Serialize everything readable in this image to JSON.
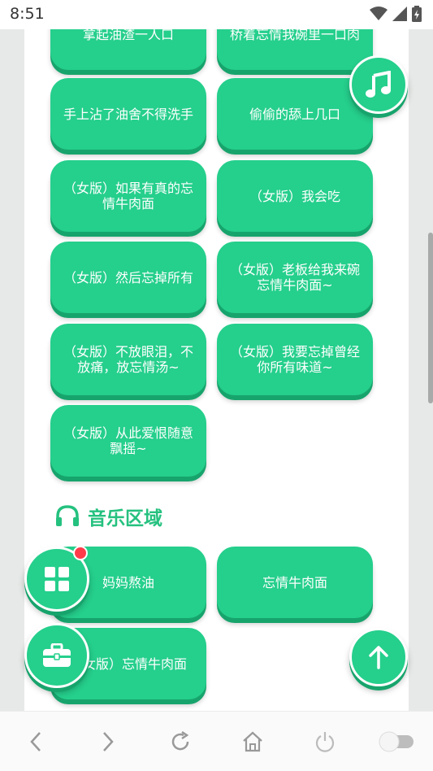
{
  "status_bar": {
    "time": "8:51"
  },
  "voice_buttons_top": [
    {
      "label": "拿起油渣一人口"
    },
    {
      "label": "桥着忘情我碗里一口肉"
    },
    {
      "label": "手上沾了油舍不得洗手"
    },
    {
      "label": "偷偷的舔上几口"
    },
    {
      "label": "（女版）如果有真的忘情牛肉面"
    },
    {
      "label": "（女版）我会吃"
    },
    {
      "label": "（女版）然后忘掉所有"
    },
    {
      "label": "（女版）老板给我来碗忘情牛肉面~"
    },
    {
      "label": "（女版）不放眼泪，不放痛，放忘情汤~"
    },
    {
      "label": "（女版）我要忘掉曾经你所有味道~"
    },
    {
      "label": "（女版）从此爱恨随意飘摇~"
    }
  ],
  "music_section": {
    "title": "音乐区域",
    "items": [
      {
        "label": "妈妈熬油"
      },
      {
        "label": "忘情牛肉面"
      },
      {
        "label": "（女版）忘情牛肉面"
      }
    ]
  },
  "colors": {
    "accent": "#25cf8c",
    "accent_dark": "#17a46c",
    "badge": "#ff3b4a"
  }
}
